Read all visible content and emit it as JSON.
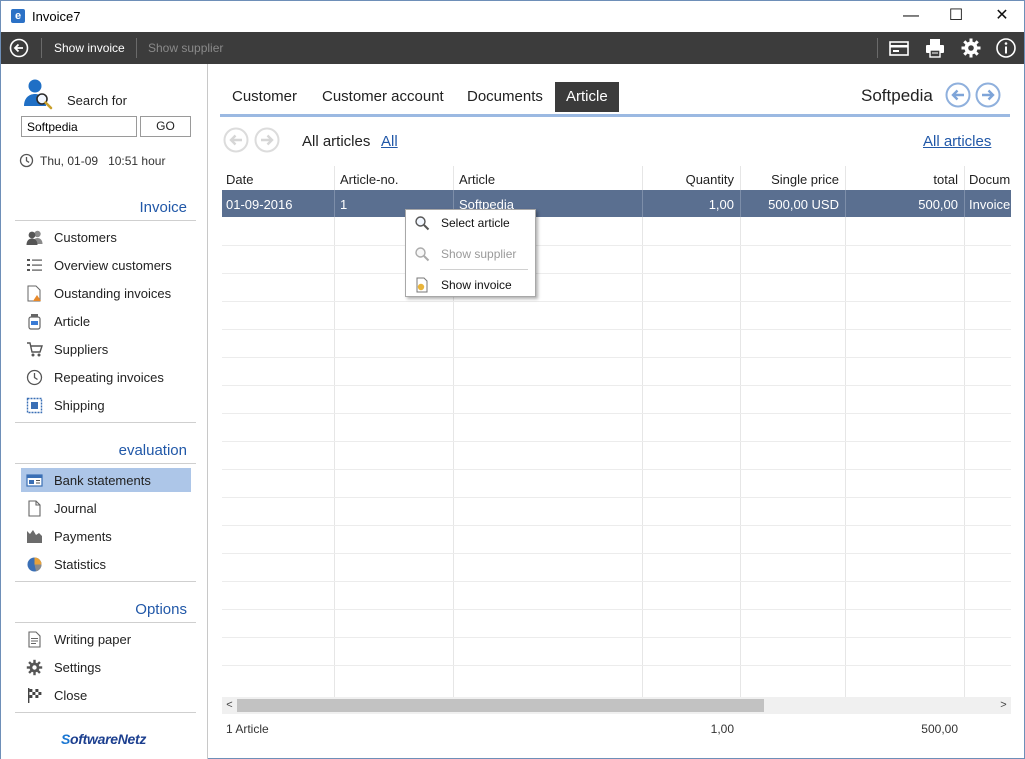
{
  "window": {
    "title": "Invoice7",
    "app_icon_letter": "e",
    "minimize_glyph": "—",
    "maximize_glyph": "☐",
    "close_glyph": "✕"
  },
  "toolbar": {
    "back_icon": "back-arrow-icon",
    "show_invoice_label": "Show invoice",
    "show_supplier_label": "Show supplier",
    "right_icons": [
      "card-icon",
      "printer-icon",
      "gear-icon",
      "info-icon"
    ]
  },
  "sidebar": {
    "search_label": "Search for",
    "search_value": "Softpedia",
    "go_label": "GO",
    "date_text": "Thu, 01-09",
    "time_text": "10:51 hour",
    "sections": {
      "invoice": {
        "title": "Invoice",
        "items": [
          {
            "label": "Customers",
            "icon": "users-icon"
          },
          {
            "label": "Overview customers",
            "icon": "list-icon"
          },
          {
            "label": "Oustanding invoices",
            "icon": "warning-document-icon"
          },
          {
            "label": "Article",
            "icon": "jar-icon"
          },
          {
            "label": "Suppliers",
            "icon": "cart-icon"
          },
          {
            "label": "Repeating invoices",
            "icon": "clock-icon"
          },
          {
            "label": "Shipping",
            "icon": "stamp-icon"
          }
        ]
      },
      "evaluation": {
        "title": "evaluation",
        "items": [
          {
            "label": "Bank statements",
            "icon": "bank-statement-icon",
            "active": true
          },
          {
            "label": "Journal",
            "icon": "document-icon"
          },
          {
            "label": "Payments",
            "icon": "payments-icon"
          },
          {
            "label": "Statistics",
            "icon": "pie-chart-icon"
          }
        ]
      },
      "options": {
        "title": "Options",
        "items": [
          {
            "label": "Writing paper",
            "icon": "writing-paper-icon"
          },
          {
            "label": "Settings",
            "icon": "gear-icon"
          },
          {
            "label": "Close",
            "icon": "checkered-flag-icon"
          }
        ]
      }
    },
    "brand_prefix": "S",
    "brand_rest": "oftwareNetz"
  },
  "main": {
    "tabs": [
      {
        "label": "Customer"
      },
      {
        "label": "Customer account"
      },
      {
        "label": "Documents"
      },
      {
        "label": "Article",
        "active": true
      }
    ],
    "company_name": "Softpedia",
    "list_title": "All articles",
    "list_filter_link": "All",
    "all_articles_link": "All articles",
    "columns": [
      "Date",
      "Article-no.",
      "Article",
      "Quantity",
      "Single price",
      "total",
      "Docum"
    ],
    "rows": [
      {
        "date": "01-09-2016",
        "article_no": "1",
        "article": "Softpedia",
        "quantity": "1,00",
        "single_price": "500,00 USD",
        "total": "500,00",
        "document": "Invoice"
      }
    ],
    "footer": {
      "count_text": "1 Article",
      "quantity_sum": "1,00",
      "total_sum": "500,00"
    },
    "scroll_left_glyph": "<",
    "scroll_right_glyph": ">"
  },
  "context_menu": {
    "items": [
      {
        "label": "Select article",
        "icon": "magnifier-icon",
        "enabled": true
      },
      {
        "label": "Show supplier",
        "icon": "magnifier-icon",
        "enabled": false
      },
      {
        "label": "Show invoice",
        "icon": "invoice-document-icon",
        "enabled": true
      }
    ]
  },
  "watermark": "SOFTPEDIA",
  "colors": {
    "accent": "#2158a8",
    "toolbar_bg": "#3c3c3c",
    "selected_row": "#5a6f90",
    "active_nav": "#adc6e8",
    "tab_rule": "#9bb9e2"
  }
}
